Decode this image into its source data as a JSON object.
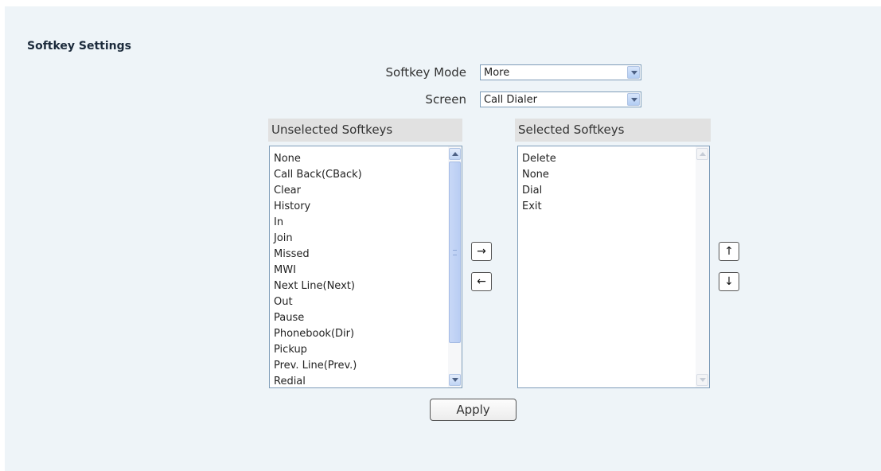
{
  "section": {
    "title": "Softkey Settings"
  },
  "softkey_mode": {
    "label": "Softkey Mode",
    "value": "More"
  },
  "screen": {
    "label": "Screen",
    "value": "Call Dialer"
  },
  "unselected": {
    "header": "Unselected Softkeys",
    "items": [
      "None",
      "Call Back(CBack)",
      "Clear",
      "History",
      "In",
      "Join",
      "Missed",
      "MWI",
      "Next Line(Next)",
      "Out",
      "Pause",
      "Phonebook(Dir)",
      "Pickup",
      "Prev. Line(Prev.)",
      "Redial"
    ]
  },
  "selected": {
    "header": "Selected Softkeys",
    "items": [
      "Delete",
      "None",
      "Dial",
      "Exit"
    ]
  },
  "buttons": {
    "move_right": "→",
    "move_left": "←",
    "move_up": "↑",
    "move_down": "↓",
    "apply": "Apply"
  }
}
